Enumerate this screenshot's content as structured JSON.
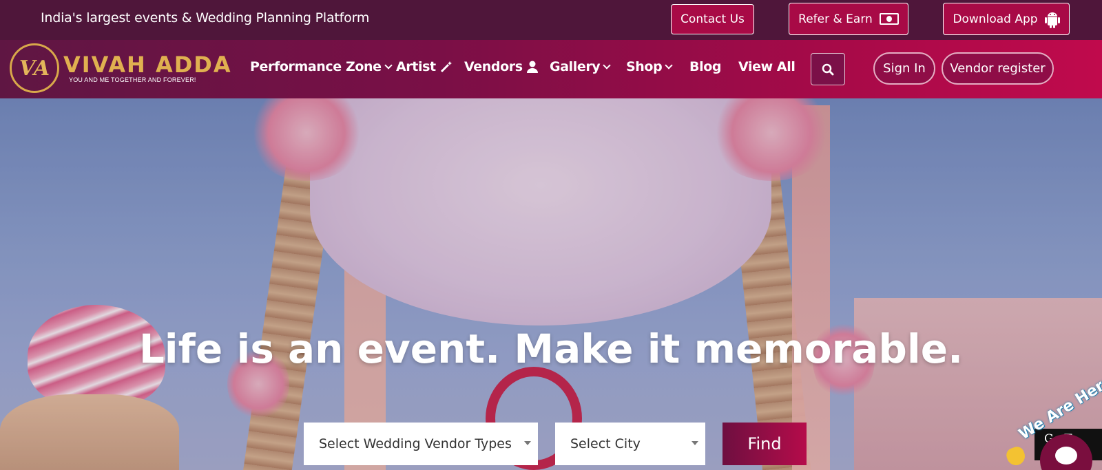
{
  "topbar": {
    "tagline": "India's largest events & Wedding Planning Platform",
    "contact_label": "Contact Us",
    "refer_label": "Refer & Earn",
    "refer_icon": "money-icon",
    "download_label": "Download App",
    "download_icon": "android-icon"
  },
  "brand": {
    "monogram": "VA",
    "name": "VIVAH ADDA",
    "tagline": "YOU AND ME TOGETHER AND FOREVER!"
  },
  "nav": {
    "items": [
      {
        "label": "Performance Zone",
        "icon": "chevron-down-icon"
      },
      {
        "label": "Artist",
        "icon": "magic-wand-icon"
      },
      {
        "label": "Vendors",
        "icon": "user-icon"
      },
      {
        "label": "Gallery",
        "icon": "chevron-down-icon"
      },
      {
        "label": "Shop",
        "icon": "chevron-down-icon"
      },
      {
        "label": "Blog"
      },
      {
        "label": "View All"
      }
    ],
    "search_icon": "search-icon",
    "signin_label": "Sign In",
    "vendor_register_label": "Vendor register"
  },
  "hero": {
    "headline": "Life is an event. Make it memorable.",
    "vendor_select": "Select Wedding Vendor Types",
    "city_select": "Select City",
    "find_label": "Find"
  },
  "widgets": {
    "we_are_here": "We Are Here",
    "go_top": "Go To Top",
    "chat_icon": "chat-icon"
  },
  "colors": {
    "topbar_bg": "#4f163a",
    "accent": "#a80a46",
    "gold": "#e0b050"
  }
}
